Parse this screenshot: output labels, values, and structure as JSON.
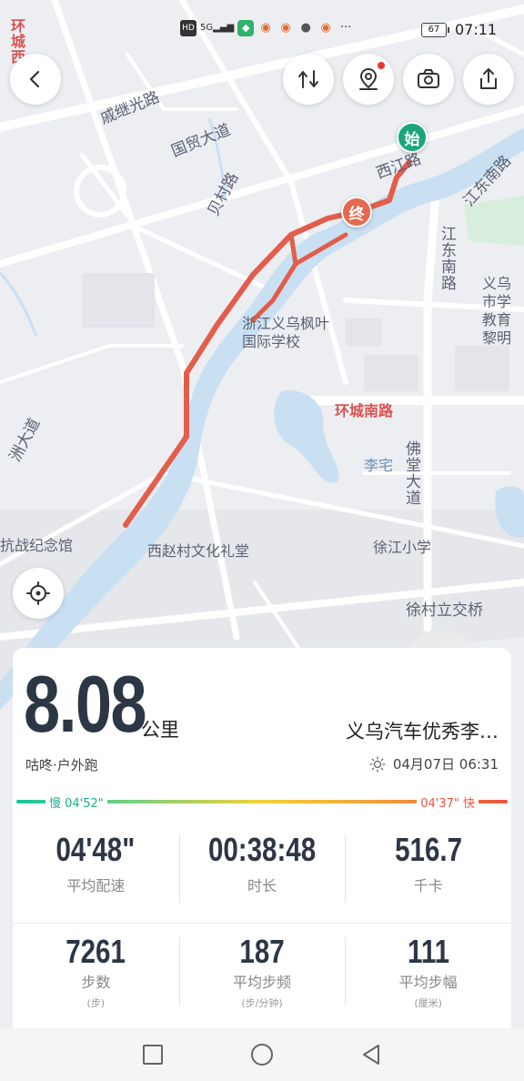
{
  "status_bar": {
    "icons": [
      "hd-icon",
      "5g-signal-icon",
      "app-icon-green",
      "weibo-icon",
      "weibo-icon",
      "wechat-icon",
      "weibo-icon",
      "more-dots-icon"
    ],
    "network": "5G",
    "battery": "67",
    "time": "07:11"
  },
  "map": {
    "labels": {
      "huancheng_xi": "环城西",
      "qijiguang_road": "戚继光路",
      "guomao_avenue": "国贸大道",
      "beicun_road": "贝村路",
      "xijiang_road": "西江路",
      "jiangdong_south_road": "江东南路",
      "jiangdong_south_road_v": "江东南路",
      "school_right": "义乌市学教育黎明",
      "school_main": "浙江义乌枫叶国际学校",
      "huancheng_south_road": "环城南路",
      "lizhai": "李宅",
      "fotang_avenue": "佛堂大道",
      "xizhaocun": "西赵村文化礼堂",
      "xujiang_school": "徐江小学",
      "xucun_bridge": "徐村立交桥",
      "memorial": "抗战纪念馆",
      "zhou_avenue": "洲大道"
    },
    "start_marker": "始",
    "end_marker": "终"
  },
  "toolbar": {
    "back": "back-icon",
    "route": "route-switch-icon",
    "location": "location-pin-icon",
    "camera": "camera-icon",
    "share": "share-icon",
    "locate": "locate-crosshair-icon"
  },
  "summary": {
    "distance": "8.08",
    "distance_unit": "公里",
    "user_name": "义乌汽车优秀李…",
    "activity": "咕咚·户外跑",
    "datetime": "04月07日 06:31",
    "pace_slow": "慢 04'52\"",
    "pace_fast": "04'37\" 快",
    "stats_row1": [
      {
        "value": "04'48\"",
        "label": "平均配速"
      },
      {
        "value": "00:38:48",
        "label": "时长"
      },
      {
        "value": "516.7",
        "label": "千卡"
      }
    ],
    "stats_row2": [
      {
        "value": "7261",
        "label": "步数",
        "sub": "(步)"
      },
      {
        "value": "187",
        "label": "平均步频",
        "sub": "(步/分钟)"
      },
      {
        "value": "111",
        "label": "平均步幅",
        "sub": "(厘米)"
      }
    ]
  },
  "colors": {
    "route": "#e35d4a",
    "river": "#c9e0f2",
    "start": "#1aa67a",
    "end": "#e46a4f",
    "text_dark": "#2d3644"
  }
}
